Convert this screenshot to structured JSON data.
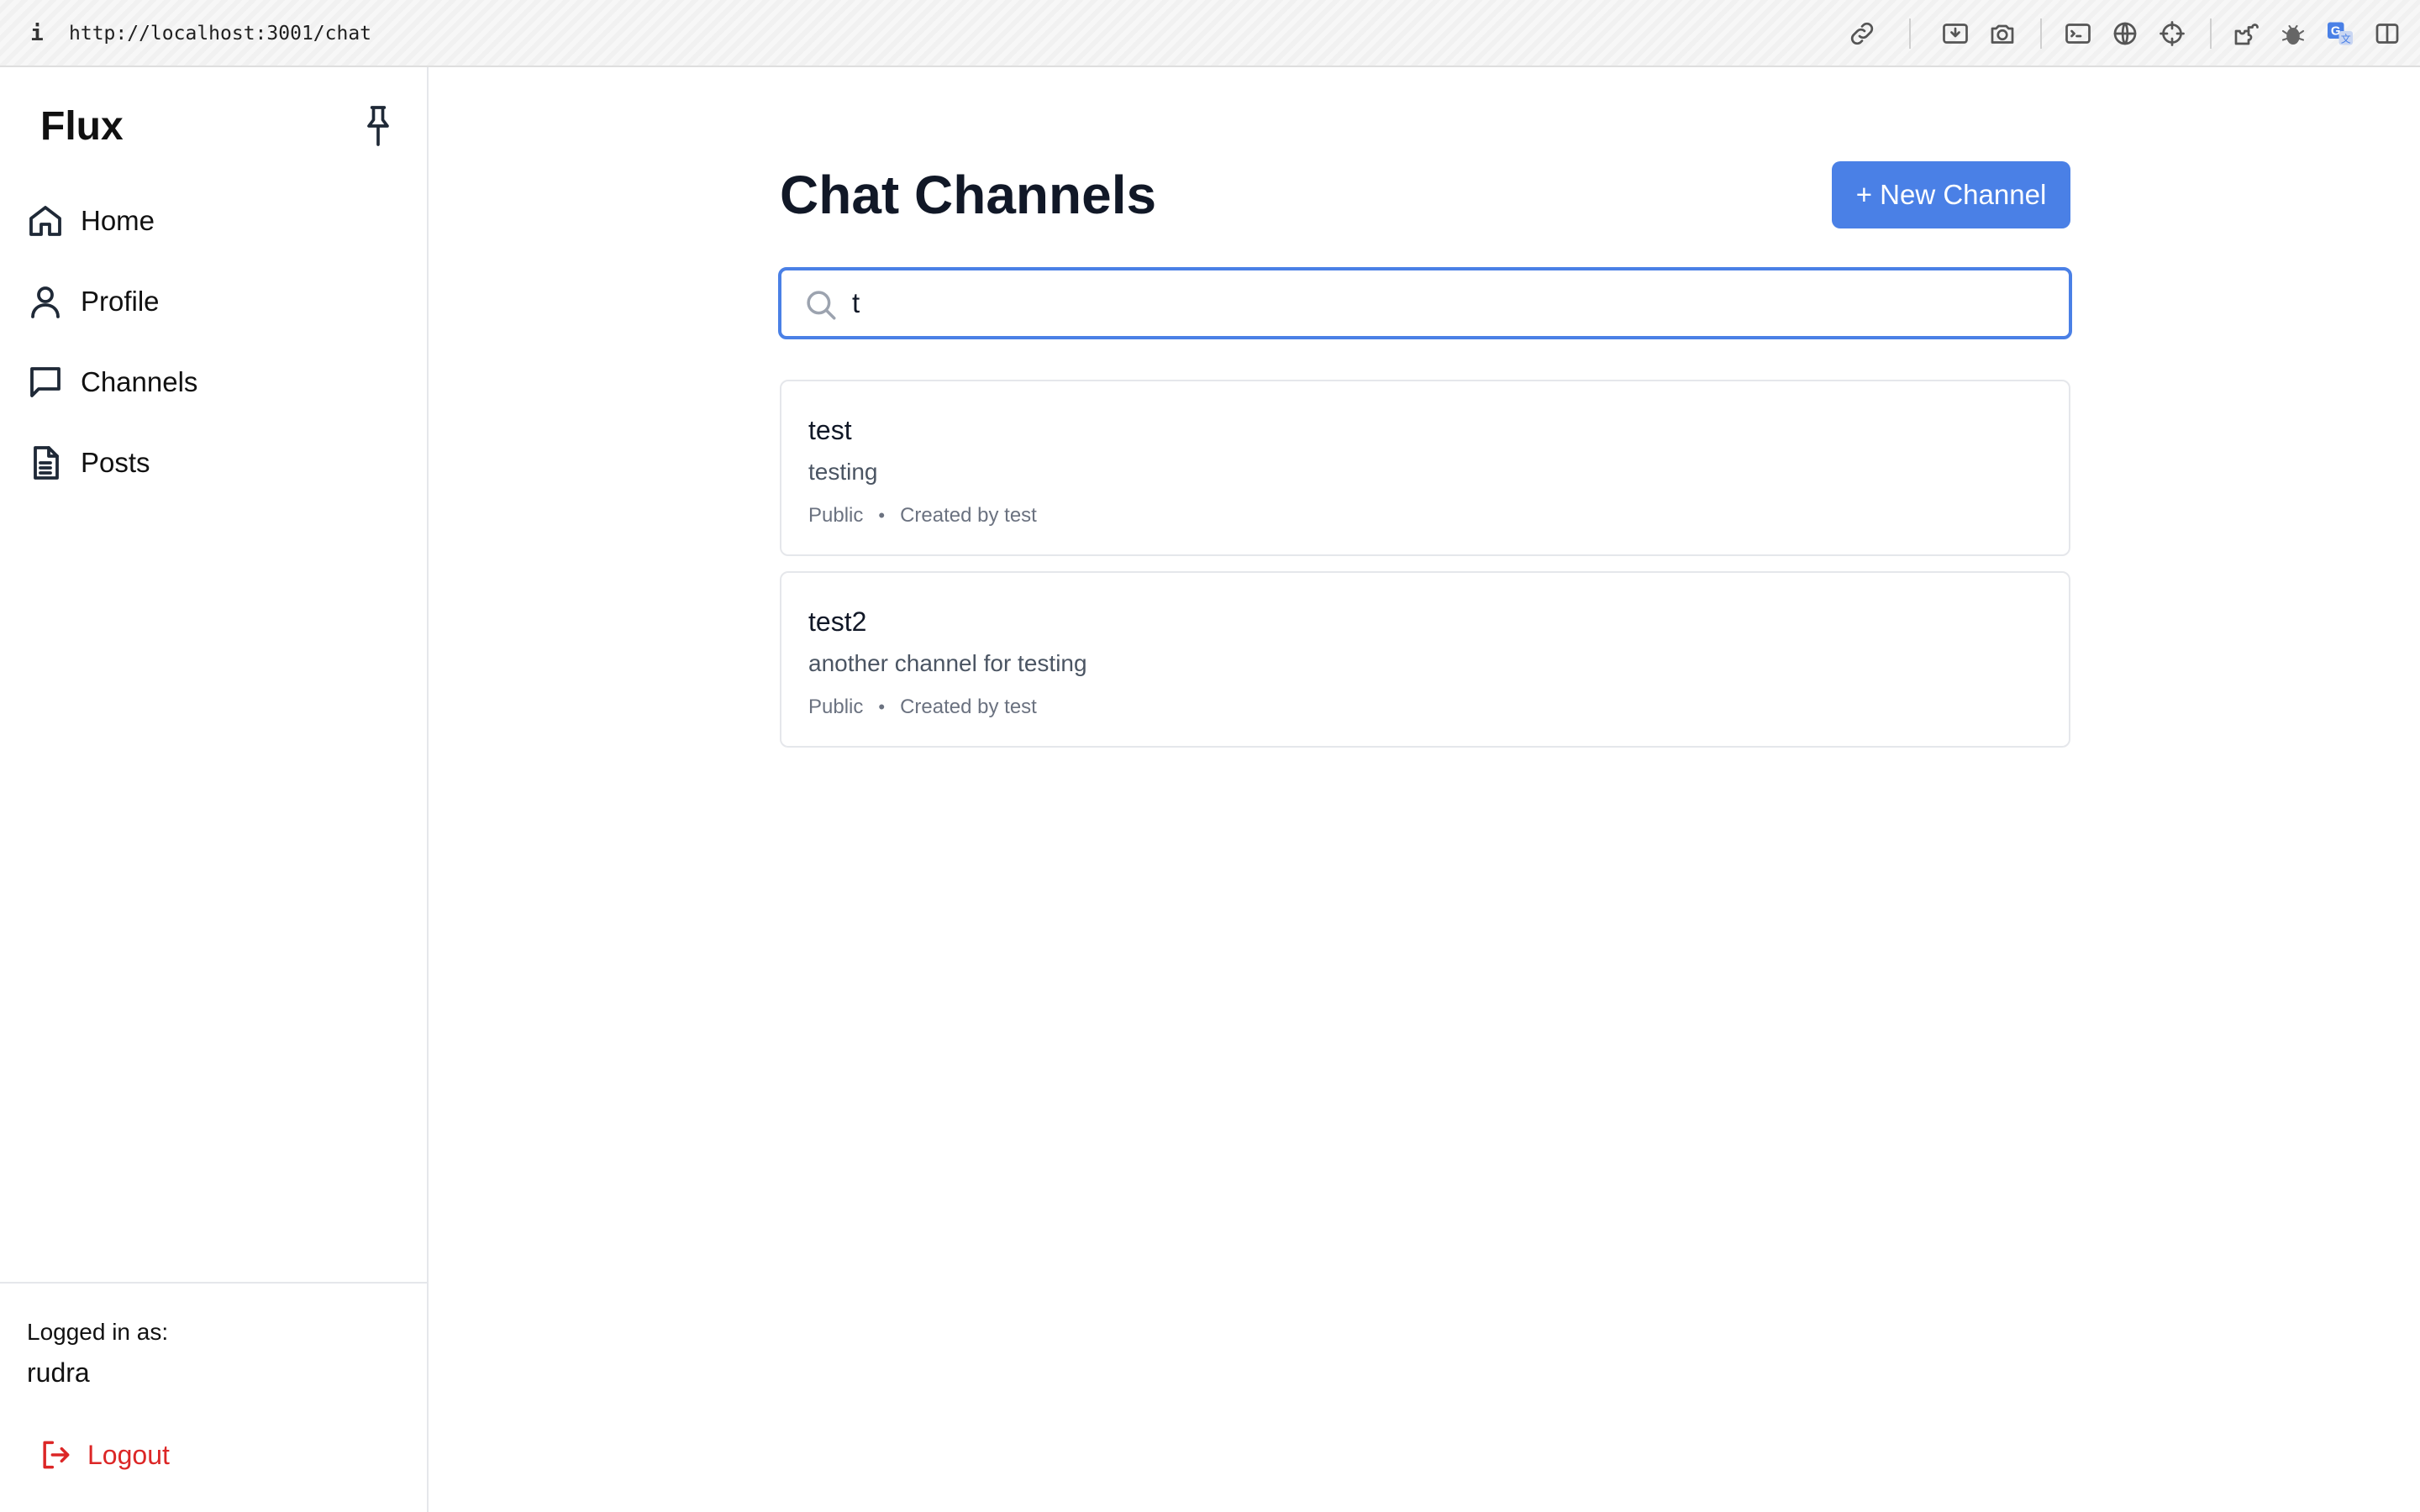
{
  "browser": {
    "info_glyph": "i",
    "url": "http://localhost:3001/chat",
    "toolbar_icons": [
      "link-icon",
      "download-icon",
      "camera-icon",
      "terminal-icon",
      "globe-icon",
      "crosshair-icon",
      "extensions-icon",
      "bug-icon",
      "translate-icon",
      "sidebar-toggle-icon"
    ]
  },
  "sidebar": {
    "brand": "Flux",
    "pin_icon": "pin-icon",
    "items": [
      {
        "label": "Home",
        "icon": "home-icon"
      },
      {
        "label": "Profile",
        "icon": "user-icon"
      },
      {
        "label": "Channels",
        "icon": "chat-bubble-icon"
      },
      {
        "label": "Posts",
        "icon": "document-icon"
      }
    ],
    "footer": {
      "logged_in_label": "Logged in as:",
      "username": "rudra",
      "logout_label": "Logout"
    }
  },
  "main": {
    "title": "Chat Channels",
    "new_channel_label": "+ New Channel",
    "search": {
      "value": "t",
      "placeholder": ""
    },
    "channels": [
      {
        "name": "test",
        "description": "testing",
        "visibility": "Public",
        "separator": "•",
        "created_by": "Created by test"
      },
      {
        "name": "test2",
        "description": "another channel for testing",
        "visibility": "Public",
        "separator": "•",
        "created_by": "Created by test"
      }
    ]
  },
  "colors": {
    "accent": "#4a80e6",
    "logout": "#dc2626",
    "border": "#e5e7eb",
    "muted_text": "#6b7280"
  }
}
